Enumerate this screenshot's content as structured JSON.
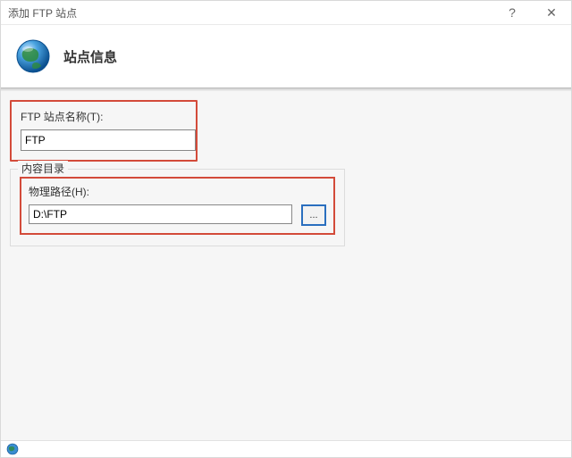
{
  "window": {
    "title": "添加 FTP 站点"
  },
  "header": {
    "heading": "站点信息"
  },
  "form": {
    "site_name": {
      "label": "FTP 站点名称(T):",
      "value": "FTP"
    },
    "content_dir": {
      "legend": "内容目录",
      "path_label": "物理路径(H):",
      "path_value": "D:\\FTP",
      "browse_label": "..."
    }
  },
  "icons": {
    "help": "?",
    "close": "✕"
  }
}
